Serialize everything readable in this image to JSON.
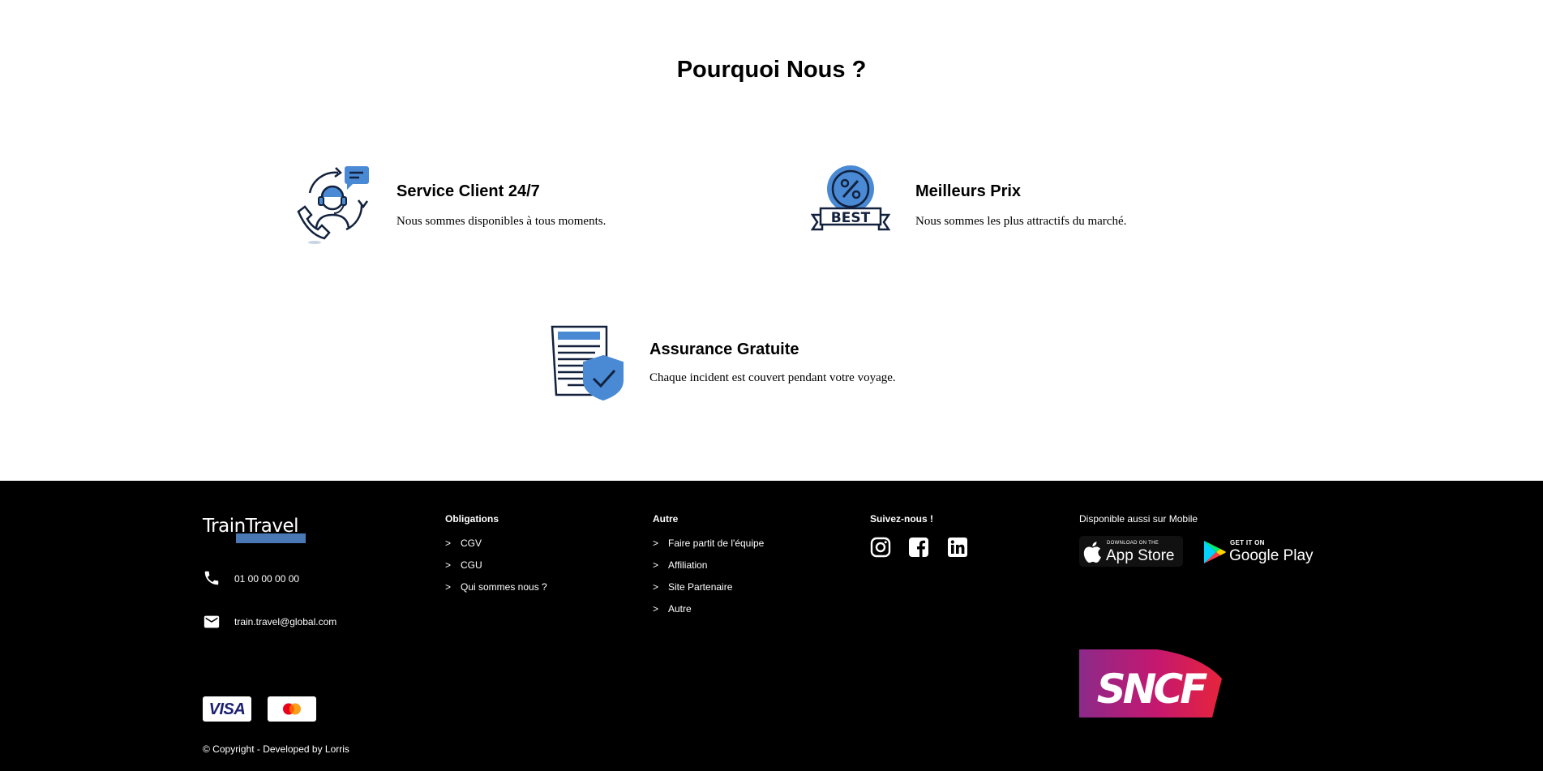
{
  "why_section": {
    "title": "Pourquoi Nous ?",
    "features": [
      {
        "title": "Service Client 24/7",
        "description": "Nous sommes disponibles à tous moments.",
        "icon": "customer-service-icon"
      },
      {
        "title": "Meilleurs Prix",
        "description": "Nous sommes les plus attractifs du marché.",
        "icon": "best-price-badge-icon"
      },
      {
        "title": "Assurance Gratuite",
        "description": "Chaque incident est couvert pendant votre voyage.",
        "icon": "insurance-document-shield-icon"
      }
    ]
  },
  "footer": {
    "logo_text": "TrainTravel",
    "phone": "01 00 00 00 00",
    "email": "train.travel@global.com",
    "payment_cards": [
      "VISA",
      "Mastercard"
    ],
    "copyright": "© Copyright - Developed by Lorris",
    "obligations": {
      "title": "Obligations",
      "links": [
        "CGV",
        "CGU",
        "Qui sommes nous ?"
      ]
    },
    "autre": {
      "title": "Autre",
      "links": [
        "Faire partit de l'équipe",
        "Affiliation",
        "Site Partenaire",
        "Autre"
      ]
    },
    "social": {
      "title": "Suivez-nous !",
      "icons": [
        "instagram-icon",
        "facebook-icon",
        "linkedin-icon"
      ]
    },
    "mobile": {
      "title": "Disponible aussi sur Mobile",
      "appstore_small": "Download on the",
      "appstore_big": "App Store",
      "googleplay_small": "GET IT ON",
      "googleplay_big": "Google Play"
    },
    "partner_logo": "SNCF",
    "chevron": ">"
  },
  "colors": {
    "accent_blue": "#4a8ad4",
    "icon_navy": "#12213d",
    "footer_bg": "#000000",
    "logo_bar": "#4a78b5"
  }
}
